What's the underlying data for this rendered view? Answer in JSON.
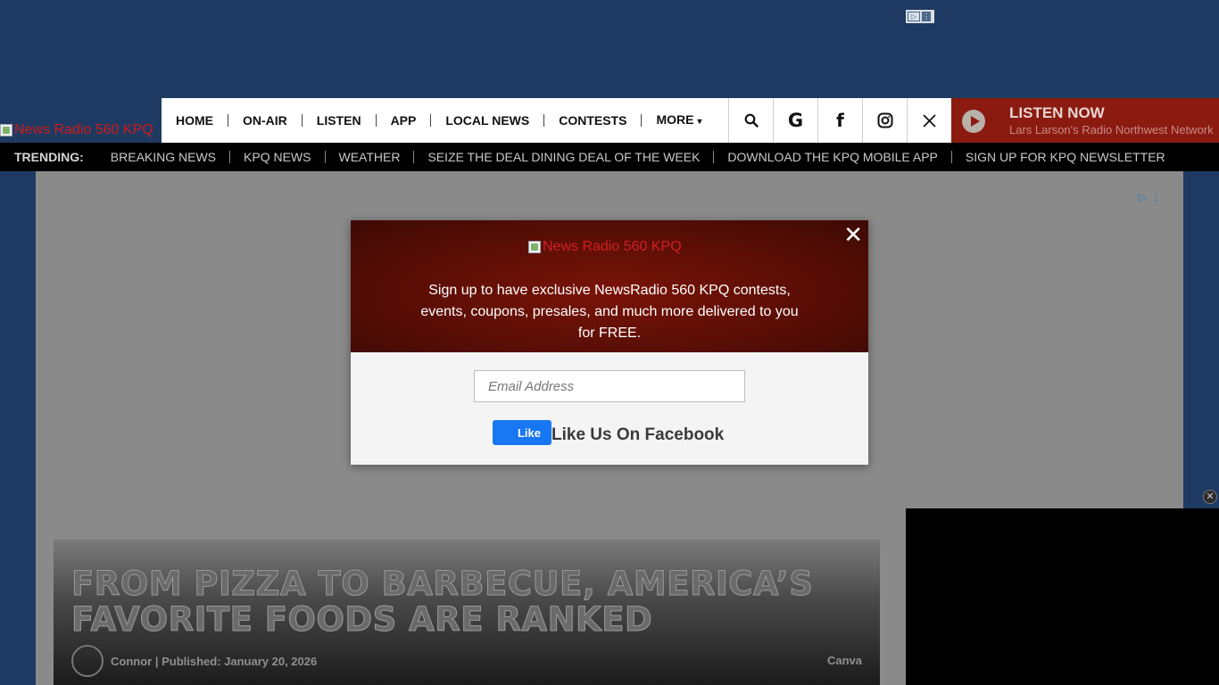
{
  "site": {
    "logo_alt": "News Radio 560 KPQ"
  },
  "nav": {
    "items": [
      "HOME",
      "ON-AIR",
      "LISTEN",
      "APP",
      "LOCAL NEWS",
      "CONTESTS",
      "MORE"
    ],
    "icons": [
      "search-icon",
      "google-icon",
      "facebook-icon",
      "instagram-icon",
      "x-icon"
    ]
  },
  "listen": {
    "title": "LISTEN NOW",
    "subtitle": "Lars Larson's Radio Northwest Network"
  },
  "trending": {
    "label": "TRENDING:",
    "items": [
      "BREAKING NEWS",
      "KPQ NEWS",
      "WEATHER",
      "SEIZE THE DEAL DINING DEAL OF THE WEEK",
      "DOWNLOAD THE KPQ MOBILE APP",
      "SIGN UP FOR KPQ NEWSLETTER"
    ]
  },
  "article": {
    "headline": "From Pizza to Barbecue, America’s Favorite Foods Are Ranked",
    "author": "Connor",
    "published": "Published: January 20, 2026",
    "credit": "Canva"
  },
  "modal": {
    "logo_alt": "News Radio 560 KPQ",
    "text": "Sign up to have exclusive NewsRadio 560 KPQ contests, events, coupons, presales, and much more delivered to you for FREE.",
    "email_placeholder": "Email Address",
    "like_label": "Like",
    "facebook_text": "Like Us On Facebook"
  },
  "colors": {
    "page_bg": "#1f3a62",
    "listen_bg": "#8b1a10",
    "facebook_blue": "#1877f2"
  }
}
